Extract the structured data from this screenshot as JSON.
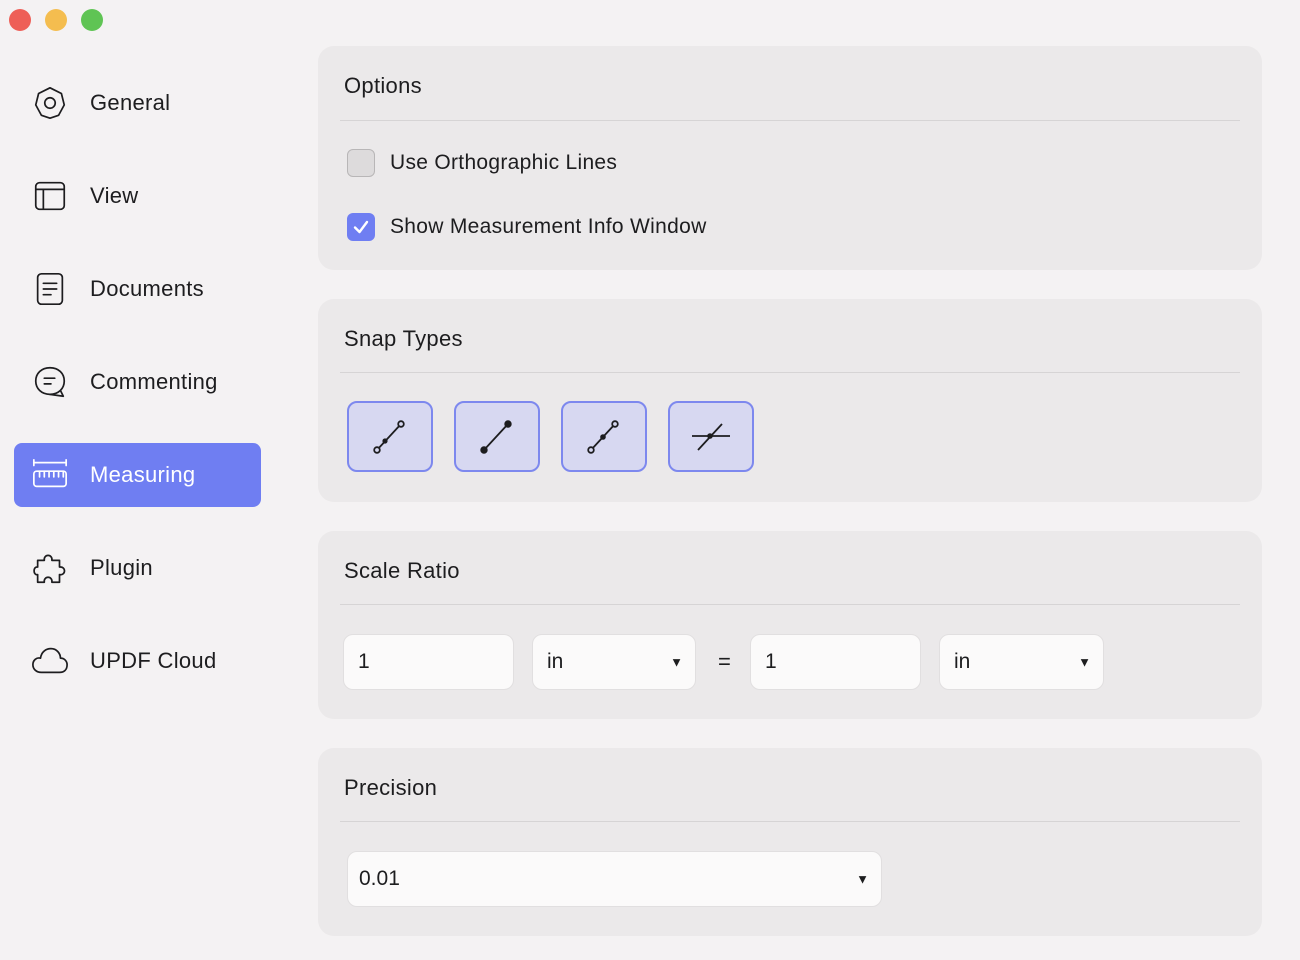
{
  "window": {
    "controls": [
      "close",
      "minimize",
      "zoom"
    ]
  },
  "sidebar": {
    "items": [
      {
        "label": "General",
        "icon": "gear-icon",
        "active": false
      },
      {
        "label": "View",
        "icon": "layout-icon",
        "active": false
      },
      {
        "label": "Documents",
        "icon": "document-icon",
        "active": false
      },
      {
        "label": "Commenting",
        "icon": "comment-icon",
        "active": false
      },
      {
        "label": "Measuring",
        "icon": "ruler-icon",
        "active": true
      },
      {
        "label": "Plugin",
        "icon": "puzzle-icon",
        "active": false
      },
      {
        "label": "UPDF Cloud",
        "icon": "cloud-icon",
        "active": false
      }
    ]
  },
  "options": {
    "title": "Options",
    "orthographic": {
      "label": "Use Orthographic Lines",
      "checked": false
    },
    "info_window": {
      "label": "Show Measurement Info Window",
      "checked": true
    }
  },
  "snap": {
    "title": "Snap Types",
    "buttons": [
      "snap-endpoint-icon",
      "snap-path-icon",
      "snap-midpoint-icon",
      "snap-intersection-icon"
    ]
  },
  "scale": {
    "title": "Scale Ratio",
    "left_value": "1",
    "left_unit": "in",
    "equals": "=",
    "right_value": "1",
    "right_unit": "in"
  },
  "precision": {
    "title": "Precision",
    "value": "0.01"
  },
  "colors": {
    "accent": "#6f7ef2",
    "panel": "#ebe9ea",
    "background": "#f4f2f3"
  }
}
